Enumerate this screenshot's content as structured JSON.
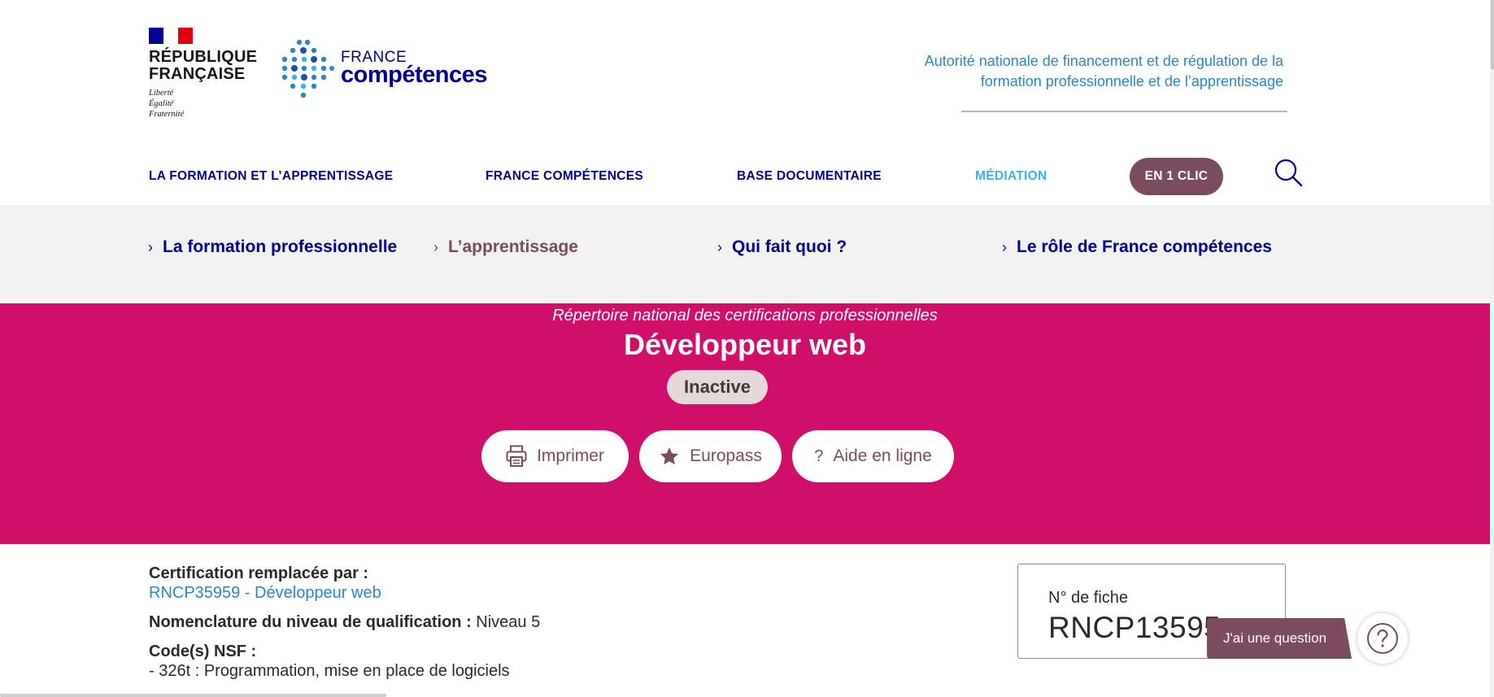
{
  "header": {
    "rf_logo": {
      "title_line1": "RÉPUBLIQUE",
      "title_line2": "FRANÇAISE",
      "motto1": "Liberté",
      "motto2": "Égalité",
      "motto3": "Fraternité"
    },
    "brand": {
      "word1": "FRANCE",
      "word2": "compétences",
      "color": "#000091"
    },
    "tagline_line1": "Autorité nationale de financement et de régulation de la",
    "tagline_line2": "formation professionnelle et de l’apprentissage"
  },
  "nav": {
    "items": [
      {
        "label": "LA FORMATION ET L’APPRENTISSAGE"
      },
      {
        "label": "FRANCE COMPÉTENCES"
      },
      {
        "label": "BASE DOCUMENTAIRE"
      },
      {
        "label": "MÉDIATION"
      }
    ],
    "cta_label": "EN 1 CLIC",
    "search_icon": "search-icon"
  },
  "subnav": {
    "items": [
      {
        "label": "La formation professionnelle"
      },
      {
        "label": "L’apprentissage"
      },
      {
        "label": "Qui fait quoi ?"
      },
      {
        "label": "Le rôle de France compétences"
      }
    ]
  },
  "banner": {
    "subtitle": "Répertoire national des certifications professionnelles",
    "title": "Développeur web",
    "status": "Inactive",
    "background": "#cf0f69",
    "actions": [
      {
        "label": "Imprimer",
        "icon": "printer-icon"
      },
      {
        "label": "Europass",
        "icon": "star-icon"
      },
      {
        "label": "Aide en ligne",
        "icon": "question-icon",
        "glyph": "?"
      }
    ]
  },
  "details": {
    "replaced_label": "Certification remplacée par :",
    "replaced_link": "RNCP35959 - Développeur web",
    "level_label": "Nomenclature du niveau de qualification :",
    "level_value": "Niveau 5",
    "nsf_label": "Code(s) NSF :",
    "nsf_value": "- 326t : Programmation, mise en place de logiciels"
  },
  "fiche": {
    "label": "N° de fiche",
    "number": "RNCP13595"
  },
  "help": {
    "question_label": "J'ai une question",
    "accent": "#7b4b5f"
  }
}
